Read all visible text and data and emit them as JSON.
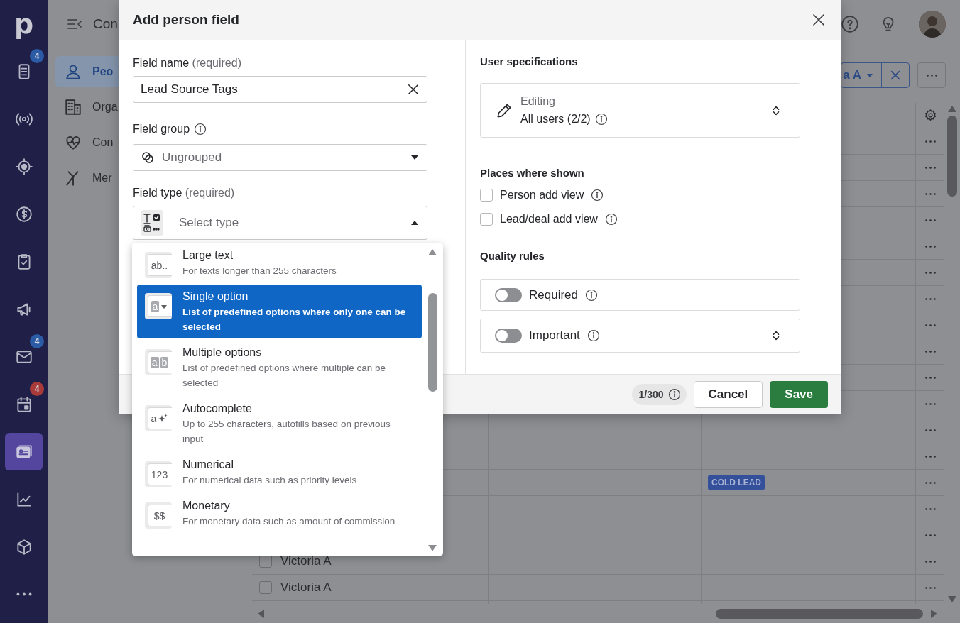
{
  "nav": {
    "logo": "p",
    "items": [
      {
        "selected": false,
        "badge": "4",
        "color": "#2c5ba6"
      },
      {
        "selected": false
      },
      {
        "selected": false
      },
      {
        "selected": false
      },
      {
        "selected": false
      },
      {
        "selected": false
      },
      {
        "selected": false,
        "badge": "4",
        "color": "#2c5ba6"
      },
      {
        "selected": false,
        "badge": "4",
        "color": "#a83a3a"
      },
      {
        "selected": true
      },
      {
        "selected": false
      },
      {
        "selected": false
      },
      {
        "selected": false
      }
    ]
  },
  "header": {
    "title": "Con"
  },
  "sidebar": {
    "items": [
      {
        "label": "Peo",
        "selected": true
      },
      {
        "label": "Orga",
        "selected": false
      },
      {
        "label": "Con",
        "selected": false
      },
      {
        "label": "Mer",
        "selected": false
      }
    ]
  },
  "filter": {
    "label": "a A"
  },
  "table": {
    "rows": [
      {
        "kind": "blank"
      },
      {
        "kind": "blank"
      },
      {
        "kind": "blank"
      },
      {
        "kind": "blank"
      },
      {
        "kind": "blank"
      },
      {
        "kind": "blank"
      },
      {
        "kind": "blank"
      },
      {
        "kind": "blank"
      },
      {
        "kind": "blank"
      },
      {
        "kind": "blank"
      },
      {
        "kind": "blank"
      },
      {
        "kind": "blank"
      },
      {
        "kind": "blank"
      },
      {
        "kind": "tag",
        "tag": "COLD LEAD"
      },
      {
        "kind": "blank"
      },
      {
        "kind": "blank"
      },
      {
        "kind": "person",
        "name": "Victoria A",
        "checked": false
      },
      {
        "kind": "person",
        "name": "Victoria A",
        "checked": false
      }
    ]
  },
  "dialog": {
    "title": "Add person field",
    "field_name": {
      "label": "Field name",
      "hint": "(required)",
      "value": "Lead Source Tags"
    },
    "field_group": {
      "label": "Field group",
      "value": "Ungrouped"
    },
    "field_type": {
      "label": "Field type",
      "hint": "(required)",
      "placeholder": "Select type",
      "expanded": true
    },
    "type_options": [
      {
        "kind": "plain",
        "tile": [
          "ab.."
        ],
        "title": "Large text",
        "description": "For texts longer than 255 characters",
        "selected": false
      },
      {
        "kind": "dropdown",
        "tile": [
          "a"
        ],
        "title": "Single option",
        "description": "List of predefined options where only one can be selected",
        "selected": true
      },
      {
        "kind": "boxed",
        "tile": [
          "a",
          "b"
        ],
        "title": "Multiple options",
        "description": "List of predefined options where multiple can be selected",
        "selected": false
      },
      {
        "kind": "sparkle",
        "tile": [
          "a"
        ],
        "title": "Autocomplete",
        "description": "Up to 255 characters, autofills based on previous input",
        "selected": false
      },
      {
        "kind": "plain",
        "tile": [
          "123"
        ],
        "title": "Numerical",
        "description": "For numerical data such as priority levels",
        "selected": false
      },
      {
        "kind": "plain",
        "tile": [
          "$$"
        ],
        "title": "Monetary",
        "description": "For monetary data such as amount of commission",
        "selected": false
      }
    ],
    "user_specs": {
      "heading": "User specifications",
      "label": "Editing",
      "value": "All users (2/2)"
    },
    "places": {
      "heading": "Places where shown",
      "options": [
        {
          "label": "Person add view",
          "checked": false
        },
        {
          "label": "Lead/deal add view",
          "checked": false
        }
      ]
    },
    "quality": {
      "heading": "Quality rules",
      "rules": [
        {
          "label": "Required",
          "on": false,
          "expandable": false
        },
        {
          "label": "Important",
          "on": false,
          "expandable": true
        }
      ]
    },
    "footer": {
      "counter": "1/300",
      "cancel": "Cancel",
      "save": "Save"
    }
  }
}
